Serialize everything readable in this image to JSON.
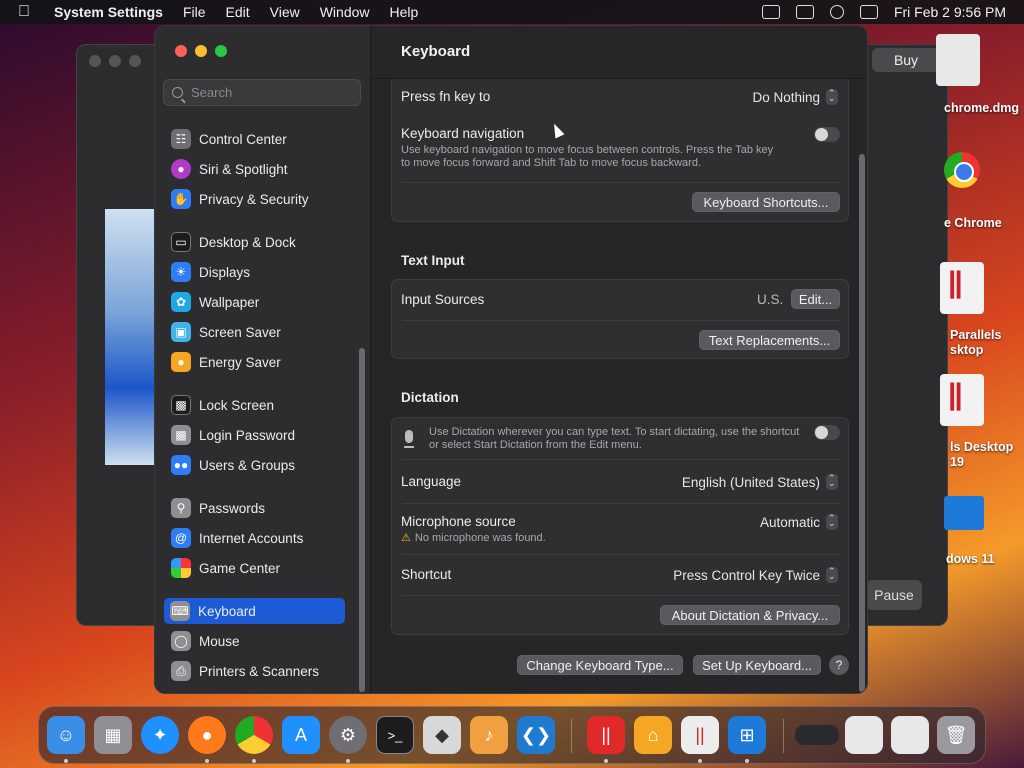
{
  "menubar": {
    "app_name": "System Settings",
    "items": [
      "File",
      "Edit",
      "View",
      "Window",
      "Help"
    ],
    "datetime": "Fri Feb 2  9:56 PM"
  },
  "background_window": {
    "buy_label": "Buy",
    "pause_label": "Pause"
  },
  "desktop": {
    "items": [
      {
        "label": "chrome.dmg"
      },
      {
        "label": "e Chrome"
      },
      {
        "label": "Parallels sktop"
      },
      {
        "label": "ls Desktop 19"
      },
      {
        "label": "dows 11"
      }
    ]
  },
  "sidebar": {
    "search_placeholder": "Search",
    "items": [
      {
        "label": "Control Center",
        "icon": "control-center-icon",
        "color": "#6e6e73"
      },
      {
        "label": "Siri & Spotlight",
        "icon": "siri-icon",
        "color": "#b03ac9"
      },
      {
        "label": "Privacy & Security",
        "icon": "hand-icon",
        "color": "#2e7cf6"
      },
      {
        "label": "Desktop & Dock",
        "icon": "dock-icon",
        "color": "#1c1c1e"
      },
      {
        "label": "Displays",
        "icon": "sun-icon",
        "color": "#2e7cf6"
      },
      {
        "label": "Wallpaper",
        "icon": "flower-icon",
        "color": "#1fa8e8"
      },
      {
        "label": "Screen Saver",
        "icon": "screensaver-icon",
        "color": "#40b4e8"
      },
      {
        "label": "Energy Saver",
        "icon": "bulb-icon",
        "color": "#f5a623"
      },
      {
        "label": "Lock Screen",
        "icon": "lock-icon",
        "color": "#1c1c1e"
      },
      {
        "label": "Login Password",
        "icon": "padlock-icon",
        "color": "#8e8e93"
      },
      {
        "label": "Users & Groups",
        "icon": "users-icon",
        "color": "#2e7cf6"
      },
      {
        "label": "Passwords",
        "icon": "key-icon",
        "color": "#8e8e93"
      },
      {
        "label": "Internet Accounts",
        "icon": "at-icon",
        "color": "#2e7cf6"
      },
      {
        "label": "Game Center",
        "icon": "game-center-icon",
        "color": "#e8e8e8"
      },
      {
        "label": "Keyboard",
        "icon": "keyboard-icon",
        "color": "#8e8e93"
      },
      {
        "label": "Mouse",
        "icon": "mouse-icon",
        "color": "#8e8e93"
      },
      {
        "label": "Printers & Scanners",
        "icon": "printer-icon",
        "color": "#8e8e93"
      }
    ]
  },
  "content": {
    "title": "Keyboard",
    "fn_key": {
      "label": "Press fn key to",
      "value": "Do Nothing"
    },
    "keyboard_navigation": {
      "label": "Keyboard navigation",
      "description_line1": "Use keyboard navigation to move focus between controls. Press the Tab key",
      "description_line2": "to move focus forward and Shift Tab to move focus backward."
    },
    "keyboard_shortcuts_button": "Keyboard Shortcuts...",
    "text_input": {
      "heading": "Text Input",
      "input_sources_label": "Input Sources",
      "input_sources_value": "U.S.",
      "edit_button": "Edit...",
      "text_replacements_button": "Text Replacements..."
    },
    "dictation": {
      "heading": "Dictation",
      "description_line1": "Use Dictation wherever you can type text. To start dictating, use the shortcut",
      "description_line2": "or select Start Dictation from the Edit menu.",
      "language_label": "Language",
      "language_value": "English (United States)",
      "mic_label": "Microphone source",
      "mic_value": "Automatic",
      "mic_warning": "No microphone was found.",
      "shortcut_label": "Shortcut",
      "shortcut_value": "Press Control Key Twice",
      "about_button": "About Dictation & Privacy..."
    },
    "change_type_button": "Change Keyboard Type...",
    "setup_button": "Set Up Keyboard...",
    "help_label": "?"
  },
  "dock": {
    "apps": [
      {
        "name": "finder-icon",
        "color": "#3a8ee6"
      },
      {
        "name": "launchpad-icon",
        "color": "#8e8e93"
      },
      {
        "name": "safari-icon",
        "color": "#1e90ff"
      },
      {
        "name": "firefox-icon",
        "color": "#ff7a1a"
      },
      {
        "name": "chrome-icon",
        "color": "#e33"
      },
      {
        "name": "app-store-icon",
        "color": "#1e90ff"
      },
      {
        "name": "system-settings-icon",
        "color": "#6e6e73"
      },
      {
        "name": "terminal-icon",
        "color": "#1c1c1e"
      },
      {
        "name": "boot-camp-icon",
        "color": "#d8d8d8"
      },
      {
        "name": "garageband-icon",
        "color": "#f0a040"
      },
      {
        "name": "vscode-icon",
        "color": "#1f7ad0"
      },
      {
        "name": "parallels-icon",
        "color": "#e02a2a"
      },
      {
        "name": "home-icon",
        "color": "#f5a623"
      },
      {
        "name": "parallels-desktop-icon",
        "color": "#ececec"
      },
      {
        "name": "windows-icon",
        "color": "#1e7ad8"
      },
      {
        "name": "minimized-window-icon",
        "color": "#2a2a2e"
      },
      {
        "name": "folder-docs-icon",
        "color": "#e8e8e8"
      },
      {
        "name": "folder-docs2-icon",
        "color": "#e8e8e8"
      },
      {
        "name": "trash-icon",
        "color": "#9a9a9e"
      }
    ]
  }
}
